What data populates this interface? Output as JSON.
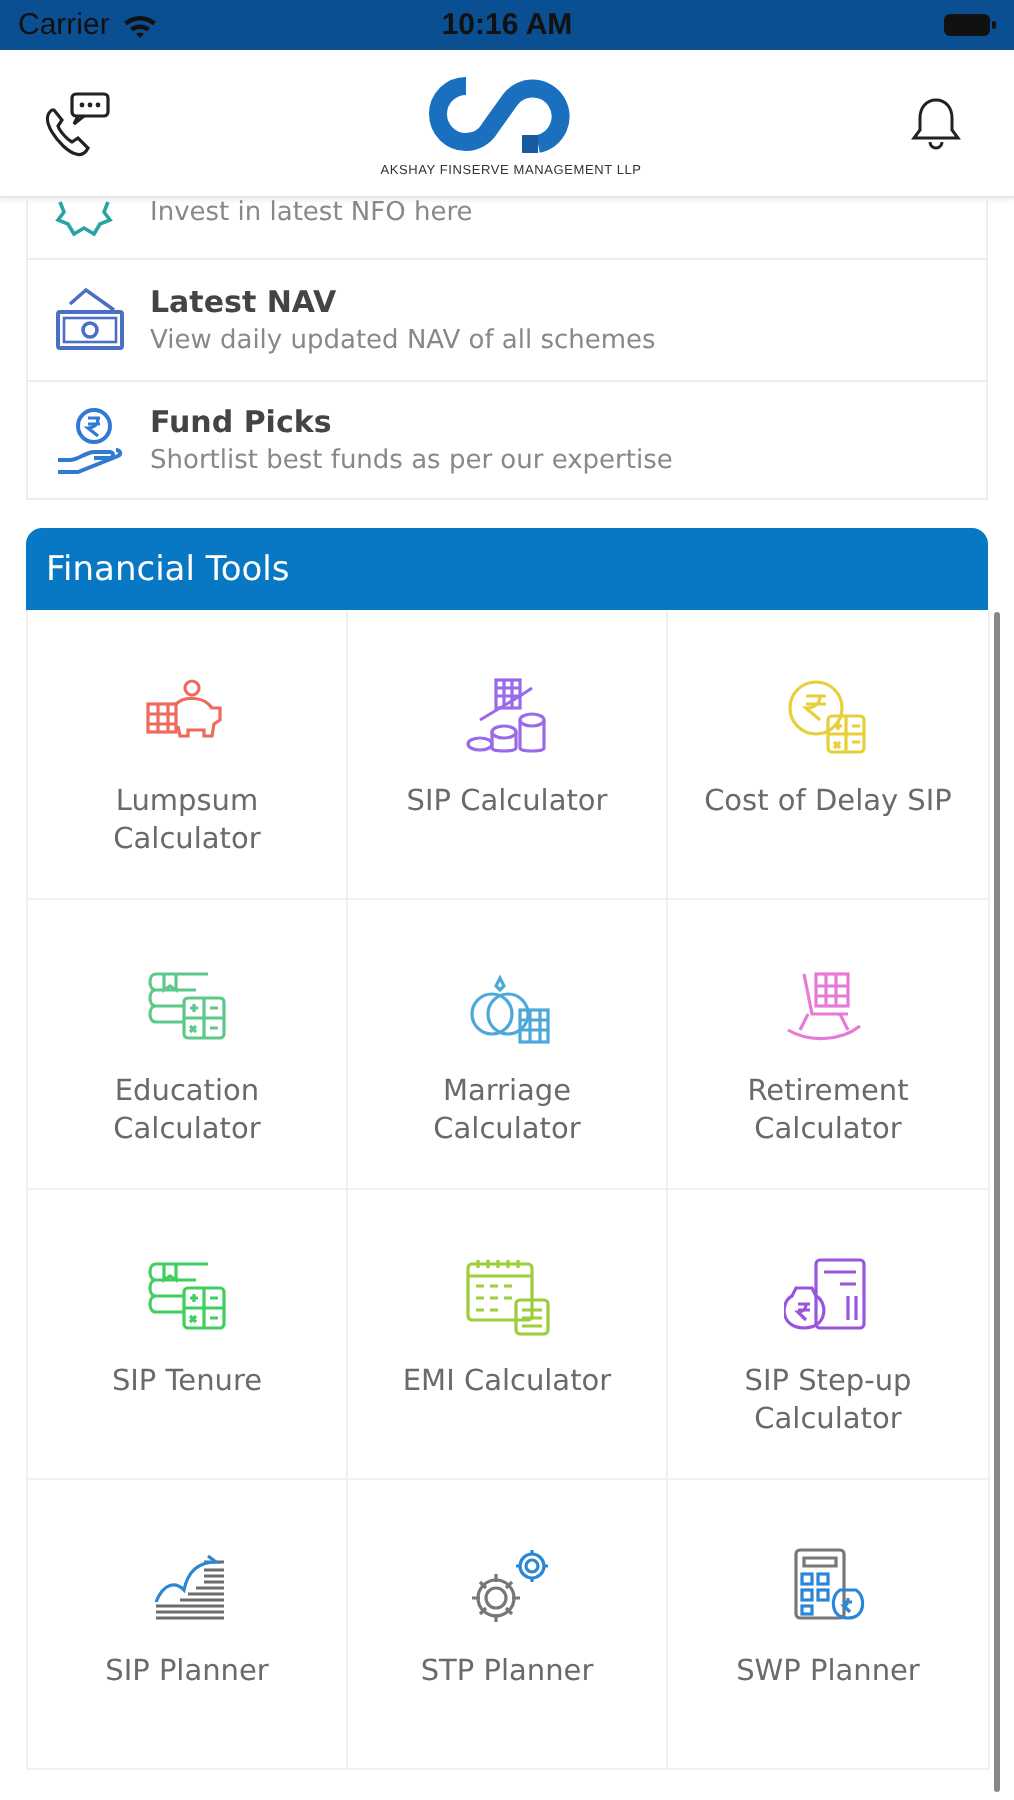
{
  "status_bar": {
    "carrier": "Carrier",
    "time": "10:16 AM"
  },
  "header": {
    "logo_text": "AKSHAY FINSERVE MANAGEMENT LLP"
  },
  "services": [
    {
      "kind": "nfo",
      "subtitle": "Invest in latest NFO here"
    },
    {
      "kind": "cash",
      "title": "Latest NAV",
      "subtitle": "View daily updated NAV of all schemes"
    },
    {
      "kind": "hand",
      "title": "Fund Picks",
      "subtitle": "Shortlist best funds as per our expertise"
    }
  ],
  "financial_tools": {
    "title": "Financial Tools",
    "tools": [
      {
        "kind": "piggy",
        "label": "Lumpsum Calculator"
      },
      {
        "kind": "coins",
        "label": "SIP Calculator"
      },
      {
        "kind": "rupee-calc",
        "label": "Cost of Delay SIP"
      },
      {
        "kind": "books",
        "label": "Education Calculator"
      },
      {
        "kind": "rings",
        "label": "Marriage Calculator"
      },
      {
        "kind": "chair",
        "label": "Retirement Calculator"
      },
      {
        "kind": "books-green",
        "label": "SIP Tenure"
      },
      {
        "kind": "calendar",
        "label": "EMI Calculator"
      },
      {
        "kind": "bag-calc",
        "label": "SIP Step-up Calculator"
      },
      {
        "kind": "growth",
        "label": "SIP Planner"
      },
      {
        "kind": "gears",
        "label": "STP Planner"
      },
      {
        "kind": "calc-bag",
        "label": "SWP Planner"
      }
    ]
  }
}
